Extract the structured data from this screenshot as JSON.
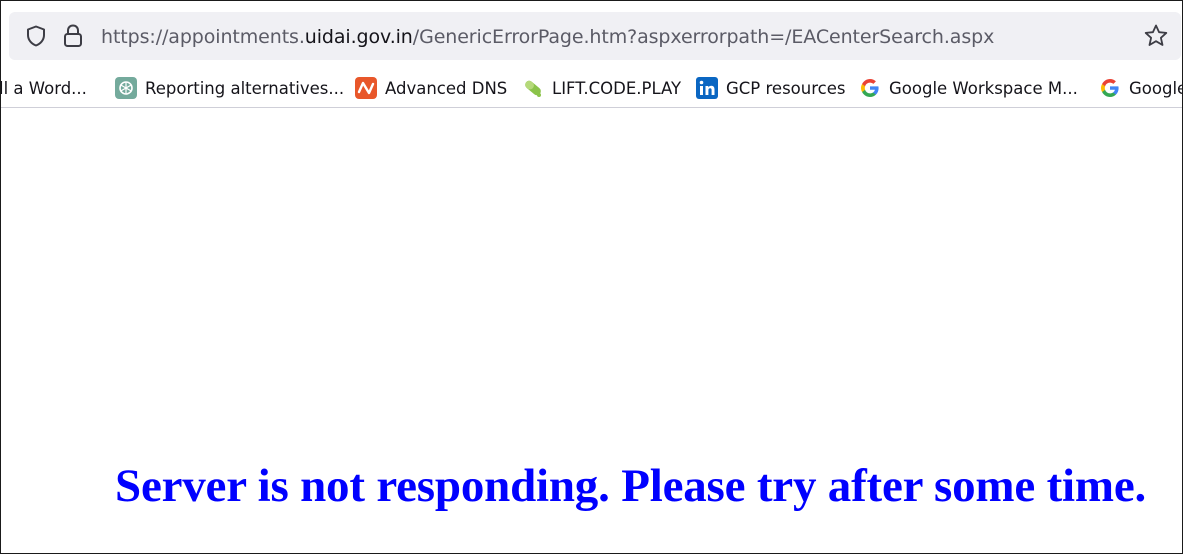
{
  "address_bar": {
    "url_prefix": "https://appointments.",
    "url_domain": "uidai.gov.in",
    "url_path": "/GenericErrorPage.htm?aspxerrorpath=/EACenterSearch.aspx"
  },
  "bookmarks": [
    {
      "label": "ll a Word...",
      "icon": "none"
    },
    {
      "label": "Reporting alternatives...",
      "icon": "openai-icon"
    },
    {
      "label": "Advanced DNS",
      "icon": "namecheap-icon"
    },
    {
      "label": "LIFT.CODE.PLAY",
      "icon": "pill-icon"
    },
    {
      "label": "GCP resources",
      "icon": "linkedin-icon"
    },
    {
      "label": "Google Workspace M...",
      "icon": "google-icon"
    },
    {
      "label": "Google",
      "icon": "google-icon"
    }
  ],
  "page": {
    "error_message": "Server is not responding. Please try after some time."
  },
  "colors": {
    "error_text": "#0000ff",
    "urlbar_bg": "#f0f0f4"
  }
}
